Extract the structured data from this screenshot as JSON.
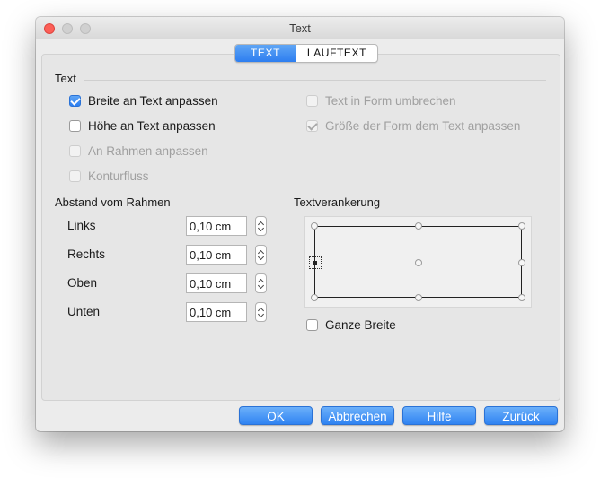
{
  "window": {
    "title": "Text"
  },
  "tabs": [
    {
      "label": "Text",
      "active": true
    },
    {
      "label": "Lauftext",
      "active": false
    }
  ],
  "text_section": {
    "title": "Text",
    "options": [
      {
        "label": "Breite an Text anpassen",
        "checked": true,
        "enabled": true
      },
      {
        "label": "Höhe an Text anpassen",
        "checked": false,
        "enabled": true
      },
      {
        "label": "An Rahmen anpassen",
        "checked": false,
        "enabled": false
      },
      {
        "label": "Konturfluss",
        "checked": false,
        "enabled": false
      },
      {
        "label": "Text in Form umbrechen",
        "checked": false,
        "enabled": false
      },
      {
        "label": "Größe der Form dem Text anpassen",
        "checked": true,
        "enabled": false
      }
    ]
  },
  "spacing": {
    "title": "Abstand vom Rahmen",
    "fields": [
      {
        "label": "Links",
        "value": "0,10 cm"
      },
      {
        "label": "Rechts",
        "value": "0,10 cm"
      },
      {
        "label": "Oben",
        "value": "0,10 cm"
      },
      {
        "label": "Unten",
        "value": "0,10 cm"
      }
    ]
  },
  "anchor": {
    "title": "Textverankerung",
    "selected": "middle-left",
    "full_width_label": "Ganze Breite",
    "full_width_checked": false
  },
  "buttons": {
    "ok": "OK",
    "cancel": "Abbrechen",
    "help": "Hilfe",
    "back": "Zurück"
  },
  "colors": {
    "accent": "#2d7ef0",
    "close": "#fc5f57"
  }
}
